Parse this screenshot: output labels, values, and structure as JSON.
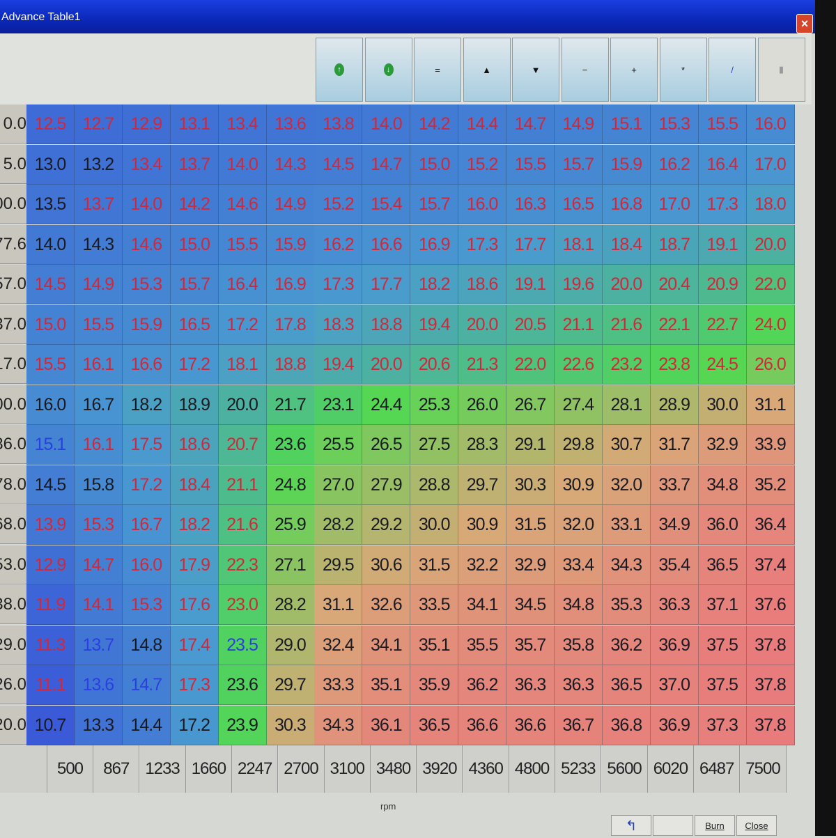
{
  "window": {
    "title": "Advance Table1",
    "close_icon": "close-icon"
  },
  "toolbar": {
    "buttons": [
      {
        "name": "increment-up",
        "icon": "arrow-up-circle-icon",
        "glyph": "↑"
      },
      {
        "name": "increment-down",
        "icon": "arrow-down-circle-icon",
        "glyph": "↓"
      },
      {
        "name": "set-equal",
        "icon": "equals-icon",
        "glyph": "="
      },
      {
        "name": "raise",
        "icon": "triangle-up-icon",
        "glyph": "▲"
      },
      {
        "name": "lower",
        "icon": "triangle-down-icon",
        "glyph": "▼"
      },
      {
        "name": "subtract",
        "icon": "minus-icon",
        "glyph": "−"
      },
      {
        "name": "add",
        "icon": "plus-icon",
        "glyph": "+"
      },
      {
        "name": "multiply",
        "icon": "asterisk-icon",
        "glyph": "*"
      },
      {
        "name": "interpolate",
        "icon": "pencil-icon",
        "glyph": "/"
      },
      {
        "name": "extra",
        "icon": "square-icon",
        "glyph": "▮"
      }
    ]
  },
  "table": {
    "row_labels": [
      "0.0",
      "5.0",
      "00.0",
      "77.6",
      "57.0",
      "37.0",
      "17.0",
      "00.0",
      "86.0",
      "78.0",
      "68.0",
      "53.0",
      "38.0",
      "29.0",
      "26.0",
      "20.0"
    ],
    "col_labels": [
      "500",
      "867",
      "1233",
      "1660",
      "2247",
      "2700",
      "3100",
      "3480",
      "3920",
      "4360",
      "4800",
      "5233",
      "5600",
      "6020",
      "6487",
      "7500"
    ],
    "x_axis_label": "rpm",
    "values": [
      [
        "12.5",
        "12.7",
        "12.9",
        "13.1",
        "13.4",
        "13.6",
        "13.8",
        "14.0",
        "14.2",
        "14.4",
        "14.7",
        "14.9",
        "15.1",
        "15.3",
        "15.5",
        "16.0"
      ],
      [
        "13.0",
        "13.2",
        "13.4",
        "13.7",
        "14.0",
        "14.3",
        "14.5",
        "14.7",
        "15.0",
        "15.2",
        "15.5",
        "15.7",
        "15.9",
        "16.2",
        "16.4",
        "17.0"
      ],
      [
        "13.5",
        "13.7",
        "14.0",
        "14.2",
        "14.6",
        "14.9",
        "15.2",
        "15.4",
        "15.7",
        "16.0",
        "16.3",
        "16.5",
        "16.8",
        "17.0",
        "17.3",
        "18.0"
      ],
      [
        "14.0",
        "14.3",
        "14.6",
        "15.0",
        "15.5",
        "15.9",
        "16.2",
        "16.6",
        "16.9",
        "17.3",
        "17.7",
        "18.1",
        "18.4",
        "18.7",
        "19.1",
        "20.0"
      ],
      [
        "14.5",
        "14.9",
        "15.3",
        "15.7",
        "16.4",
        "16.9",
        "17.3",
        "17.7",
        "18.2",
        "18.6",
        "19.1",
        "19.6",
        "20.0",
        "20.4",
        "20.9",
        "22.0"
      ],
      [
        "15.0",
        "15.5",
        "15.9",
        "16.5",
        "17.2",
        "17.8",
        "18.3",
        "18.8",
        "19.4",
        "20.0",
        "20.5",
        "21.1",
        "21.6",
        "22.1",
        "22.7",
        "24.0"
      ],
      [
        "15.5",
        "16.1",
        "16.6",
        "17.2",
        "18.1",
        "18.8",
        "19.4",
        "20.0",
        "20.6",
        "21.3",
        "22.0",
        "22.6",
        "23.2",
        "23.8",
        "24.5",
        "26.0"
      ],
      [
        "16.0",
        "16.7",
        "18.2",
        "18.9",
        "20.0",
        "21.7",
        "23.1",
        "24.4",
        "25.3",
        "26.0",
        "26.7",
        "27.4",
        "28.1",
        "28.9",
        "30.0",
        "31.1"
      ],
      [
        "15.1",
        "16.1",
        "17.5",
        "18.6",
        "20.7",
        "23.6",
        "25.5",
        "26.5",
        "27.5",
        "28.3",
        "29.1",
        "29.8",
        "30.7",
        "31.7",
        "32.9",
        "33.9"
      ],
      [
        "14.5",
        "15.8",
        "17.2",
        "18.4",
        "21.1",
        "24.8",
        "27.0",
        "27.9",
        "28.8",
        "29.7",
        "30.3",
        "30.9",
        "32.0",
        "33.7",
        "34.8",
        "35.2"
      ],
      [
        "13.9",
        "15.3",
        "16.7",
        "18.2",
        "21.6",
        "25.9",
        "28.2",
        "29.2",
        "30.0",
        "30.9",
        "31.5",
        "32.0",
        "33.1",
        "34.9",
        "36.0",
        "36.4"
      ],
      [
        "12.9",
        "14.7",
        "16.0",
        "17.9",
        "22.3",
        "27.1",
        "29.5",
        "30.6",
        "31.5",
        "32.2",
        "32.9",
        "33.4",
        "34.3",
        "35.4",
        "36.5",
        "37.4"
      ],
      [
        "11.9",
        "14.1",
        "15.3",
        "17.6",
        "23.0",
        "28.2",
        "31.1",
        "32.6",
        "33.5",
        "34.1",
        "34.5",
        "34.8",
        "35.3",
        "36.3",
        "37.1",
        "37.6"
      ],
      [
        "11.3",
        "13.7",
        "14.8",
        "17.4",
        "23.5",
        "29.0",
        "32.4",
        "34.1",
        "35.1",
        "35.5",
        "35.7",
        "35.8",
        "36.2",
        "36.9",
        "37.5",
        "37.8"
      ],
      [
        "11.1",
        "13.6",
        "14.7",
        "17.3",
        "23.6",
        "29.7",
        "33.3",
        "35.1",
        "35.9",
        "36.2",
        "36.3",
        "36.3",
        "36.5",
        "37.0",
        "37.5",
        "37.8"
      ],
      [
        "10.7",
        "13.3",
        "14.4",
        "17.2",
        "23.9",
        "30.3",
        "34.3",
        "36.1",
        "36.5",
        "36.6",
        "36.6",
        "36.7",
        "36.8",
        "36.9",
        "37.3",
        "37.8"
      ]
    ],
    "text_color_codes": [
      "rrrrrrrrrrrrrrrr",
      "kkrrrrrrrrrrrrrr",
      "krrrrrrrrrrrrrrr",
      "kkrrrrrrrrrrrrrr",
      "rrrrrrrrrrrrrrrr",
      "rrrrrrrrrrrrrrrr",
      "rrrrrrrrrrrrrrrr",
      "kkkkkkkkkkkkkkkk",
      "brrrrkkkkkkkkkkk",
      "kkrrrkkkkkkkkkkk",
      "rrrrrkkkkkkkkkkk",
      "rrrrrkkkkkkkkkkk",
      "rrrrrkkkkkkkkkkk",
      "rbkrbkkkkkkkkkkk",
      "rbbrkkkkkkkkkkkk",
      "kkkkkkkkkkkkkkkk"
    ],
    "text_colors": {
      "r": "#d0283a",
      "k": "#1a1a22",
      "b": "#2a3fe0"
    },
    "heat_colors": [
      "#3a5ad8",
      "#4a9ad0",
      "#52d852",
      "#d8a878",
      "#e87c7c"
    ]
  },
  "footer": {
    "buttons": [
      {
        "name": "undo-button",
        "glyph": "↰",
        "icon": "undo-icon"
      },
      {
        "name": "disabled-button",
        "glyph": ""
      },
      {
        "name": "burn-button",
        "label": "Burn"
      },
      {
        "name": "close-button",
        "label": "Close"
      }
    ]
  }
}
